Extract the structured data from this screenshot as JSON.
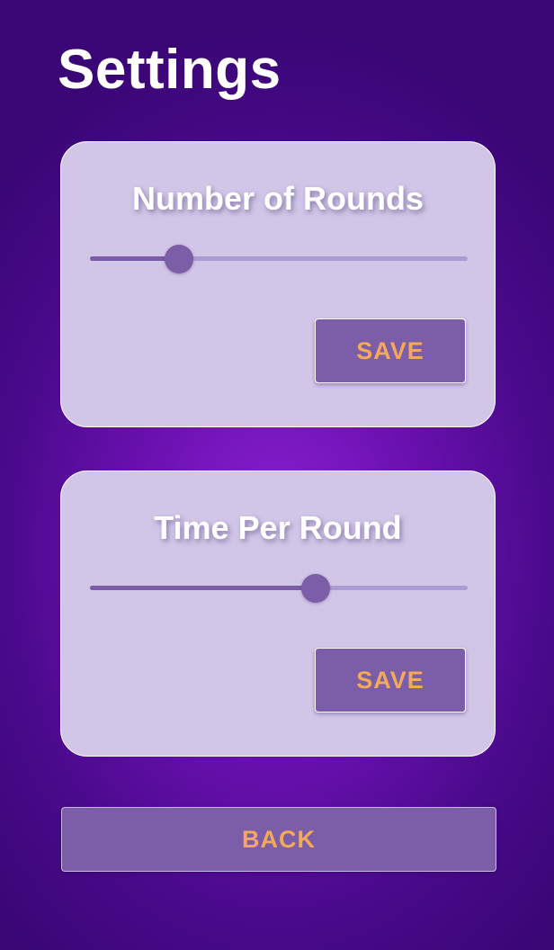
{
  "page": {
    "title": "Settings"
  },
  "rounds": {
    "title": "Number of Rounds",
    "slider_fraction": 0.235,
    "save_label": "SAVE"
  },
  "time": {
    "title": "Time Per Round",
    "slider_fraction": 0.597,
    "save_label": "SAVE"
  },
  "back_label": "BACK",
  "colors": {
    "card_background": "#d1c6e7",
    "accent_purple": "#7b5ea7",
    "button_text": "#f3a85a",
    "page_background": "#6a10b0"
  }
}
